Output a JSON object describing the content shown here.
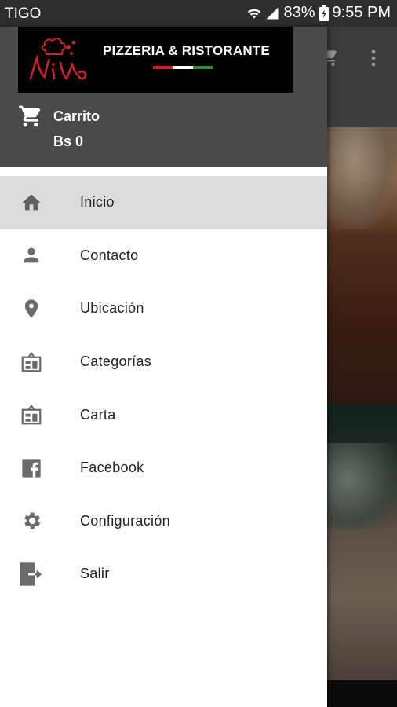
{
  "status_bar": {
    "carrier": "TIGO",
    "battery": "83%",
    "time": "9:55 PM"
  },
  "drawer": {
    "logo_text": "PIZZERIA & RISTORANTE",
    "cart_label": "Carrito",
    "cart_total": "Bs 0",
    "items": [
      {
        "label": "Inicio",
        "icon": "home-icon",
        "active": true
      },
      {
        "label": "Contacto",
        "icon": "person-icon"
      },
      {
        "label": "Ubicación",
        "icon": "location-pin-icon"
      },
      {
        "label": "Categorías",
        "icon": "menu-board-icon"
      },
      {
        "label": "Carta",
        "icon": "menu-board-icon"
      },
      {
        "label": "Facebook",
        "icon": "facebook-icon"
      },
      {
        "label": "Configuración",
        "icon": "gear-icon"
      },
      {
        "label": "Salir",
        "icon": "exit-icon"
      }
    ]
  },
  "colors": {
    "header_bg": "#4a4a4a",
    "active_item_bg": "#dcdcdc",
    "icon_gray": "#6b6b6b",
    "flag_green": "#2e8b3a",
    "flag_white": "#ffffff",
    "flag_red": "#d11f2a"
  }
}
